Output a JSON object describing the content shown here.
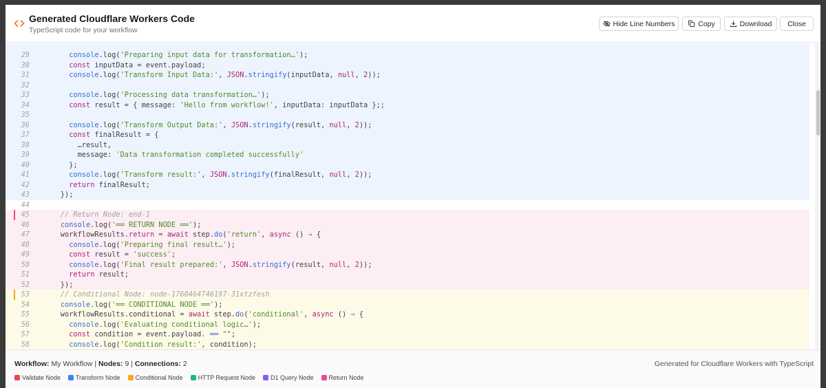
{
  "header": {
    "title": "Generated Cloudflare Workers Code",
    "subtitle": "TypeScript code for your workflow",
    "buttons": {
      "hide_line_numbers": "Hide Line Numbers",
      "copy": "Copy",
      "download": "Download",
      "close": "Close"
    }
  },
  "colors": {
    "validate": "#e5484d",
    "transform": "#3b82f6",
    "conditional": "#f5a524",
    "http": "#17b890",
    "d1": "#8b5cf6",
    "return": "#ec4899",
    "blue_section_bg": "#eef4fd",
    "pink_section_bg": "#fdeef3",
    "yellow_section_bg": "#fefae8"
  },
  "footer": {
    "workflow_label": "Workflow:",
    "workflow_name": "My Workflow",
    "nodes_label": "Nodes:",
    "nodes_count": "9",
    "connections_label": "Connections:",
    "connections_count": "2",
    "separator": "|",
    "generated_text": "Generated for Cloudflare Workers with TypeScript",
    "legend": [
      {
        "label": "Validate Node",
        "color": "#e5484d"
      },
      {
        "label": "Transform Node",
        "color": "#3b82f6"
      },
      {
        "label": "Conditional Node",
        "color": "#f5a524"
      },
      {
        "label": "HTTP Request Node",
        "color": "#17b890"
      },
      {
        "label": "D1 Query Node",
        "color": "#8b5cf6"
      },
      {
        "label": "Return Node",
        "color": "#ec4899"
      }
    ]
  },
  "code_lines": [
    {
      "n": "29",
      "section": "blue",
      "tokens": [
        [
          "",
          "      "
        ],
        [
          "f",
          "console"
        ],
        [
          "",
          ".log("
        ],
        [
          "s",
          "'Preparing input data for transformation…'"
        ],
        [
          "",
          ");"
        ]
      ]
    },
    {
      "n": "30",
      "section": "blue",
      "tokens": [
        [
          "",
          "      "
        ],
        [
          "k",
          "const"
        ],
        [
          "",
          " inputData = event.payload;"
        ]
      ]
    },
    {
      "n": "31",
      "section": "blue",
      "tokens": [
        [
          "",
          "      "
        ],
        [
          "f",
          "console"
        ],
        [
          "",
          ".log("
        ],
        [
          "s",
          "'Transform Input Data:'"
        ],
        [
          "",
          ", "
        ],
        [
          "n",
          "JSON"
        ],
        [
          "",
          "."
        ],
        [
          "f",
          "stringify"
        ],
        [
          "",
          "(inputData, "
        ],
        [
          "k",
          "null"
        ],
        [
          "",
          ", "
        ],
        [
          "n",
          "2"
        ],
        [
          "",
          "));"
        ]
      ]
    },
    {
      "n": "32",
      "section": "blue",
      "tokens": []
    },
    {
      "n": "33",
      "section": "blue",
      "tokens": [
        [
          "",
          "      "
        ],
        [
          "f",
          "console"
        ],
        [
          "",
          ".log("
        ],
        [
          "s",
          "'Processing data transformation…'"
        ],
        [
          "",
          ");"
        ]
      ]
    },
    {
      "n": "34",
      "section": "blue",
      "tokens": [
        [
          "",
          "      "
        ],
        [
          "k",
          "const"
        ],
        [
          "",
          " result = { message: "
        ],
        [
          "s",
          "'Hello from workflow!'"
        ],
        [
          "",
          ", inputData: inputData };;"
        ]
      ]
    },
    {
      "n": "35",
      "section": "blue",
      "tokens": []
    },
    {
      "n": "36",
      "section": "blue",
      "tokens": [
        [
          "",
          "      "
        ],
        [
          "f",
          "console"
        ],
        [
          "",
          ".log("
        ],
        [
          "s",
          "'Transform Output Data:'"
        ],
        [
          "",
          ", "
        ],
        [
          "n",
          "JSON"
        ],
        [
          "",
          "."
        ],
        [
          "f",
          "stringify"
        ],
        [
          "",
          "(result, "
        ],
        [
          "k",
          "null"
        ],
        [
          "",
          ", "
        ],
        [
          "n",
          "2"
        ],
        [
          "",
          "));"
        ]
      ]
    },
    {
      "n": "37",
      "section": "blue",
      "tokens": [
        [
          "",
          "      "
        ],
        [
          "k",
          "const"
        ],
        [
          "",
          " finalResult = {"
        ]
      ]
    },
    {
      "n": "38",
      "section": "blue",
      "tokens": [
        [
          "",
          "        …result,"
        ]
      ]
    },
    {
      "n": "39",
      "section": "blue",
      "tokens": [
        [
          "",
          "        message: "
        ],
        [
          "s",
          "'Data transformation completed successfully'"
        ]
      ]
    },
    {
      "n": "40",
      "section": "blue",
      "tokens": [
        [
          "",
          "      };"
        ]
      ]
    },
    {
      "n": "41",
      "section": "blue",
      "tokens": [
        [
          "",
          "      "
        ],
        [
          "f",
          "console"
        ],
        [
          "",
          ".log("
        ],
        [
          "s",
          "'Transform result:'"
        ],
        [
          "",
          ", "
        ],
        [
          "n",
          "JSON"
        ],
        [
          "",
          "."
        ],
        [
          "f",
          "stringify"
        ],
        [
          "",
          "(finalResult, "
        ],
        [
          "k",
          "null"
        ],
        [
          "",
          ", "
        ],
        [
          "n",
          "2"
        ],
        [
          "",
          "));"
        ]
      ]
    },
    {
      "n": "42",
      "section": "blue",
      "tokens": [
        [
          "",
          "      "
        ],
        [
          "k",
          "return"
        ],
        [
          "",
          " finalResult;"
        ]
      ]
    },
    {
      "n": "43",
      "section": "blue",
      "tokens": [
        [
          "",
          "    });"
        ]
      ]
    },
    {
      "n": "44",
      "section": "none",
      "tokens": []
    },
    {
      "n": "45",
      "section": "pink",
      "tokens": [
        [
          "c",
          "    // Return Node: end-1"
        ]
      ]
    },
    {
      "n": "46",
      "section": "pink",
      "tokens": [
        [
          "",
          "    "
        ],
        [
          "f",
          "console"
        ],
        [
          "",
          ".log("
        ],
        [
          "s",
          "'══ RETURN NODE ══'"
        ],
        [
          "",
          ");"
        ]
      ]
    },
    {
      "n": "47",
      "section": "pink",
      "tokens": [
        [
          "",
          "    workflowResults."
        ],
        [
          "k",
          "return"
        ],
        [
          "",
          " = "
        ],
        [
          "k",
          "await"
        ],
        [
          "",
          " step."
        ],
        [
          "f",
          "do"
        ],
        [
          "",
          "("
        ],
        [
          "s",
          "'return'"
        ],
        [
          "",
          ", "
        ],
        [
          "k",
          "async"
        ],
        [
          "",
          " () "
        ],
        [
          "f",
          "⇒"
        ],
        [
          "",
          " {"
        ]
      ]
    },
    {
      "n": "48",
      "section": "pink",
      "tokens": [
        [
          "",
          "      "
        ],
        [
          "f",
          "console"
        ],
        [
          "",
          ".log("
        ],
        [
          "s",
          "'Preparing final result…'"
        ],
        [
          "",
          ");"
        ]
      ]
    },
    {
      "n": "49",
      "section": "pink",
      "tokens": [
        [
          "",
          "      "
        ],
        [
          "k",
          "const"
        ],
        [
          "",
          " result = "
        ],
        [
          "s",
          "'success'"
        ],
        [
          "",
          ";"
        ]
      ]
    },
    {
      "n": "50",
      "section": "pink",
      "tokens": [
        [
          "",
          "      "
        ],
        [
          "f",
          "console"
        ],
        [
          "",
          ".log("
        ],
        [
          "s",
          "'Final result prepared:'"
        ],
        [
          "",
          ", "
        ],
        [
          "n",
          "JSON"
        ],
        [
          "",
          "."
        ],
        [
          "f",
          "stringify"
        ],
        [
          "",
          "(result, "
        ],
        [
          "k",
          "null"
        ],
        [
          "",
          ", "
        ],
        [
          "n",
          "2"
        ],
        [
          "",
          "));"
        ]
      ]
    },
    {
      "n": "51",
      "section": "pink",
      "tokens": [
        [
          "",
          "      "
        ],
        [
          "k",
          "return"
        ],
        [
          "",
          " result;"
        ]
      ]
    },
    {
      "n": "52",
      "section": "pink",
      "tokens": [
        [
          "",
          "    });"
        ]
      ]
    },
    {
      "n": "53",
      "section": "yellow",
      "tokens": [
        [
          "c",
          "    // Conditional Node: node-1760464746197-31xtzfesh"
        ]
      ]
    },
    {
      "n": "54",
      "section": "yellow",
      "tokens": [
        [
          "",
          "    "
        ],
        [
          "f",
          "console"
        ],
        [
          "",
          ".log("
        ],
        [
          "s",
          "'══ CONDITIONAL NODE ══'"
        ],
        [
          "",
          ");"
        ]
      ]
    },
    {
      "n": "55",
      "section": "yellow",
      "tokens": [
        [
          "",
          "    workflowResults.conditional = "
        ],
        [
          "k",
          "await"
        ],
        [
          "",
          " step."
        ],
        [
          "f",
          "do"
        ],
        [
          "",
          "("
        ],
        [
          "s",
          "'conditional'"
        ],
        [
          "",
          ", "
        ],
        [
          "k",
          "async"
        ],
        [
          "",
          " () "
        ],
        [
          "f",
          "⇒"
        ],
        [
          "",
          " {"
        ]
      ]
    },
    {
      "n": "56",
      "section": "yellow",
      "tokens": [
        [
          "",
          "      "
        ],
        [
          "f",
          "console"
        ],
        [
          "",
          ".log("
        ],
        [
          "s",
          "'Evaluating conditional logic…'"
        ],
        [
          "",
          ");"
        ]
      ]
    },
    {
      "n": "57",
      "section": "yellow",
      "tokens": [
        [
          "",
          "      "
        ],
        [
          "k",
          "const"
        ],
        [
          "",
          " condition = event.payload. "
        ],
        [
          "f",
          "══"
        ],
        [
          "",
          " "
        ],
        [
          "s",
          "\"\""
        ],
        [
          "",
          ";"
        ]
      ]
    },
    {
      "n": "58",
      "section": "yellow",
      "tokens": [
        [
          "",
          "      "
        ],
        [
          "f",
          "console"
        ],
        [
          "",
          ".log("
        ],
        [
          "s",
          "'Condition result:'"
        ],
        [
          "",
          ", condition);"
        ]
      ]
    }
  ]
}
